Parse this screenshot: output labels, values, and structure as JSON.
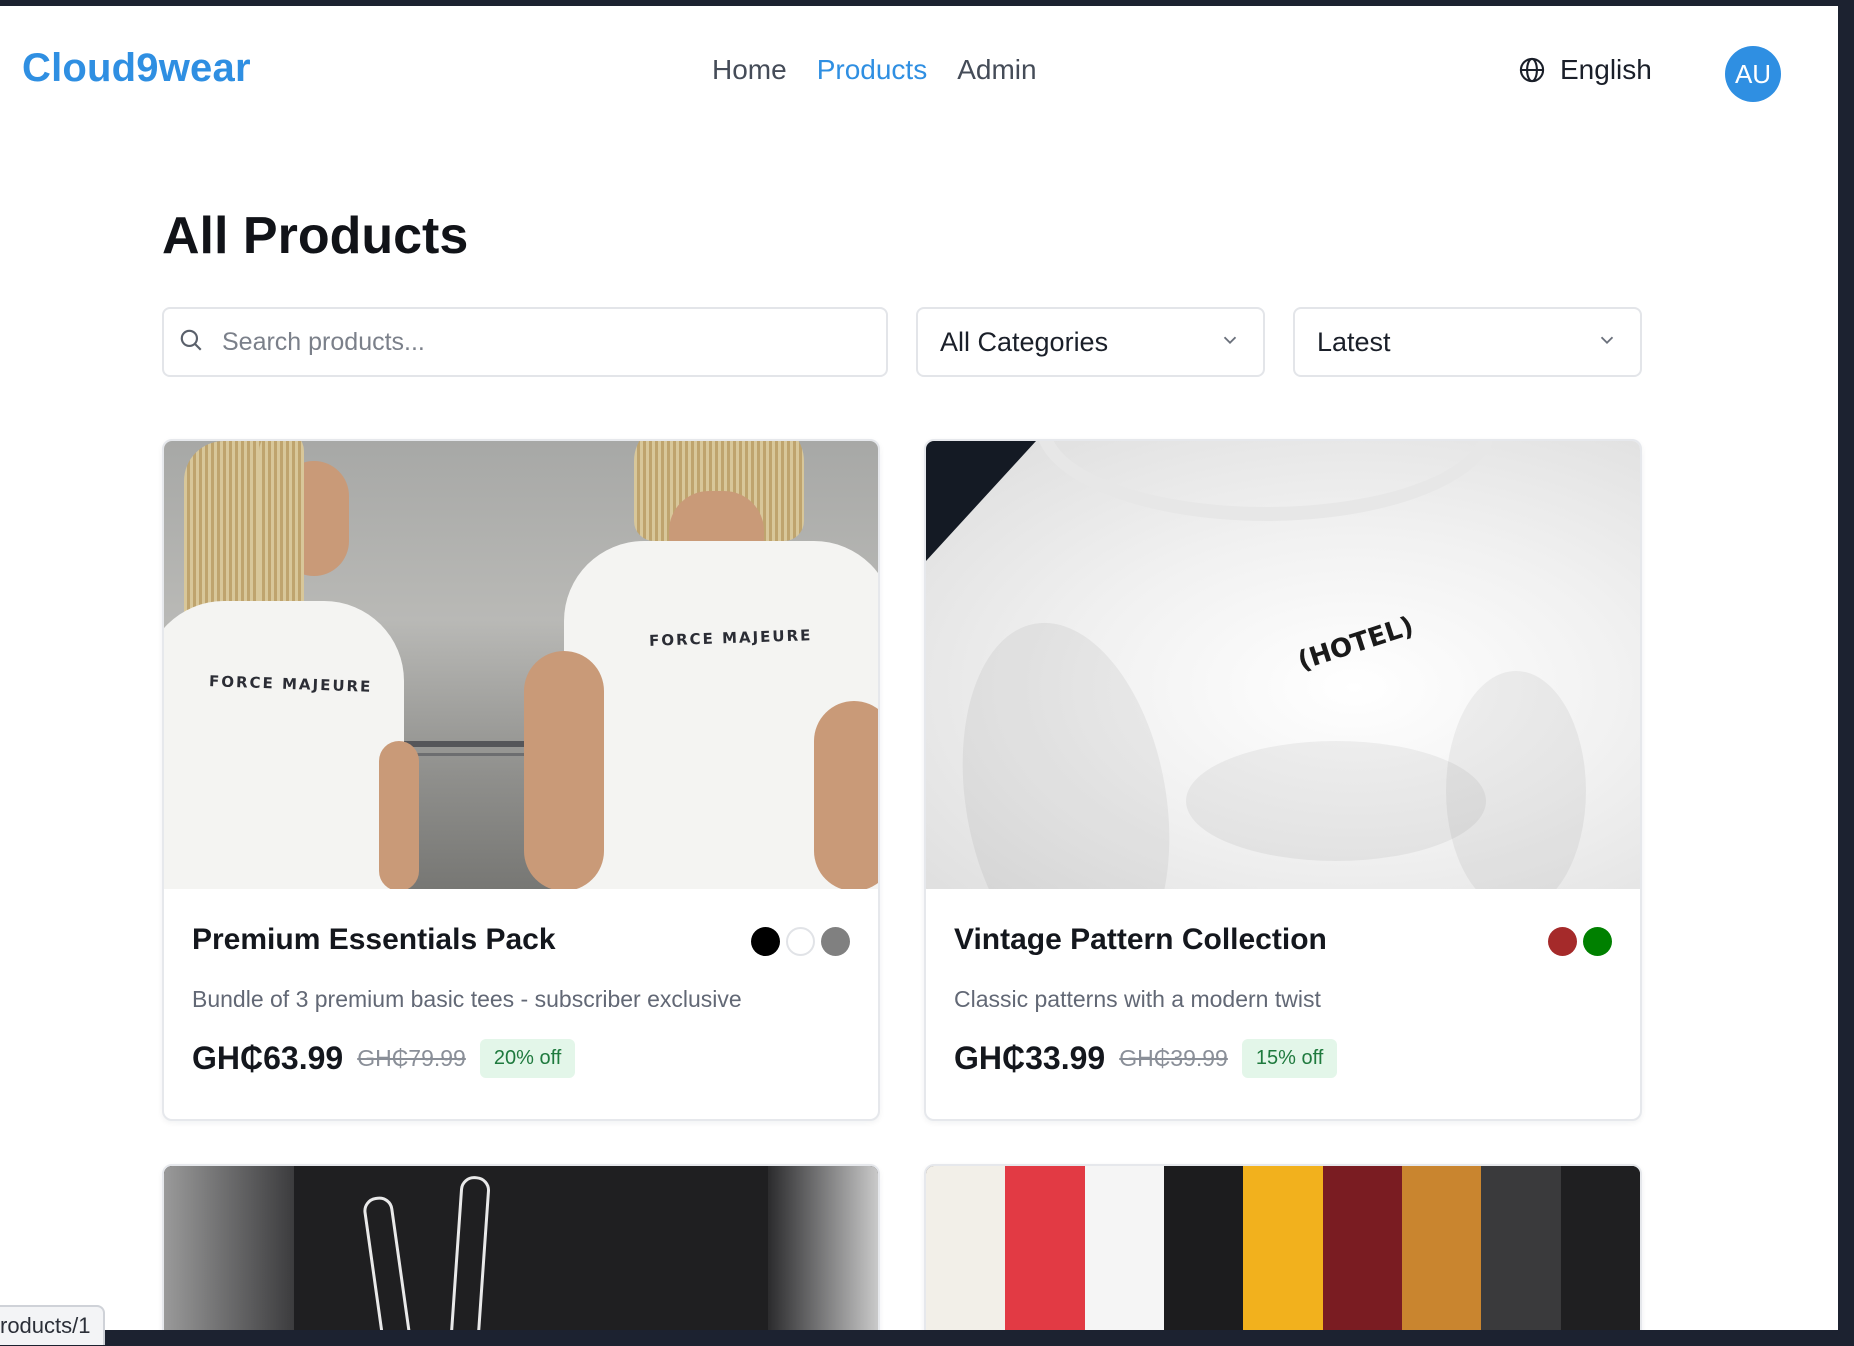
{
  "nav": {
    "brand": "Cloud9wear",
    "links": [
      "Home",
      "Products",
      "Admin"
    ],
    "active_link": "Products",
    "language": "English",
    "avatar_initials": "AU",
    "accent_color": "#2f8fe2"
  },
  "page": {
    "title": "All Products"
  },
  "filters": {
    "search_placeholder": "Search products...",
    "category_value": "All Categories",
    "sort_value": "Latest"
  },
  "products": [
    {
      "name": "Premium Essentials Pack",
      "description": "Bundle of 3 premium basic tees - subscriber exclusive",
      "price": "GH₵63.99",
      "old_price": "GH₵79.99",
      "discount": "20% off",
      "colors": [
        "#000000",
        "#ffffff",
        "#808080"
      ],
      "image_text": "FORCE MAJEURE"
    },
    {
      "name": "Vintage Pattern Collection",
      "description": "Classic patterns with a modern twist",
      "price": "GH₵33.99",
      "old_price": "GH₵39.99",
      "discount": "15% off",
      "colors": [
        "#a52a2a",
        "#008000"
      ],
      "image_text": "(HOTEL)"
    }
  ],
  "status_bar": {
    "url": "roducts/1"
  }
}
